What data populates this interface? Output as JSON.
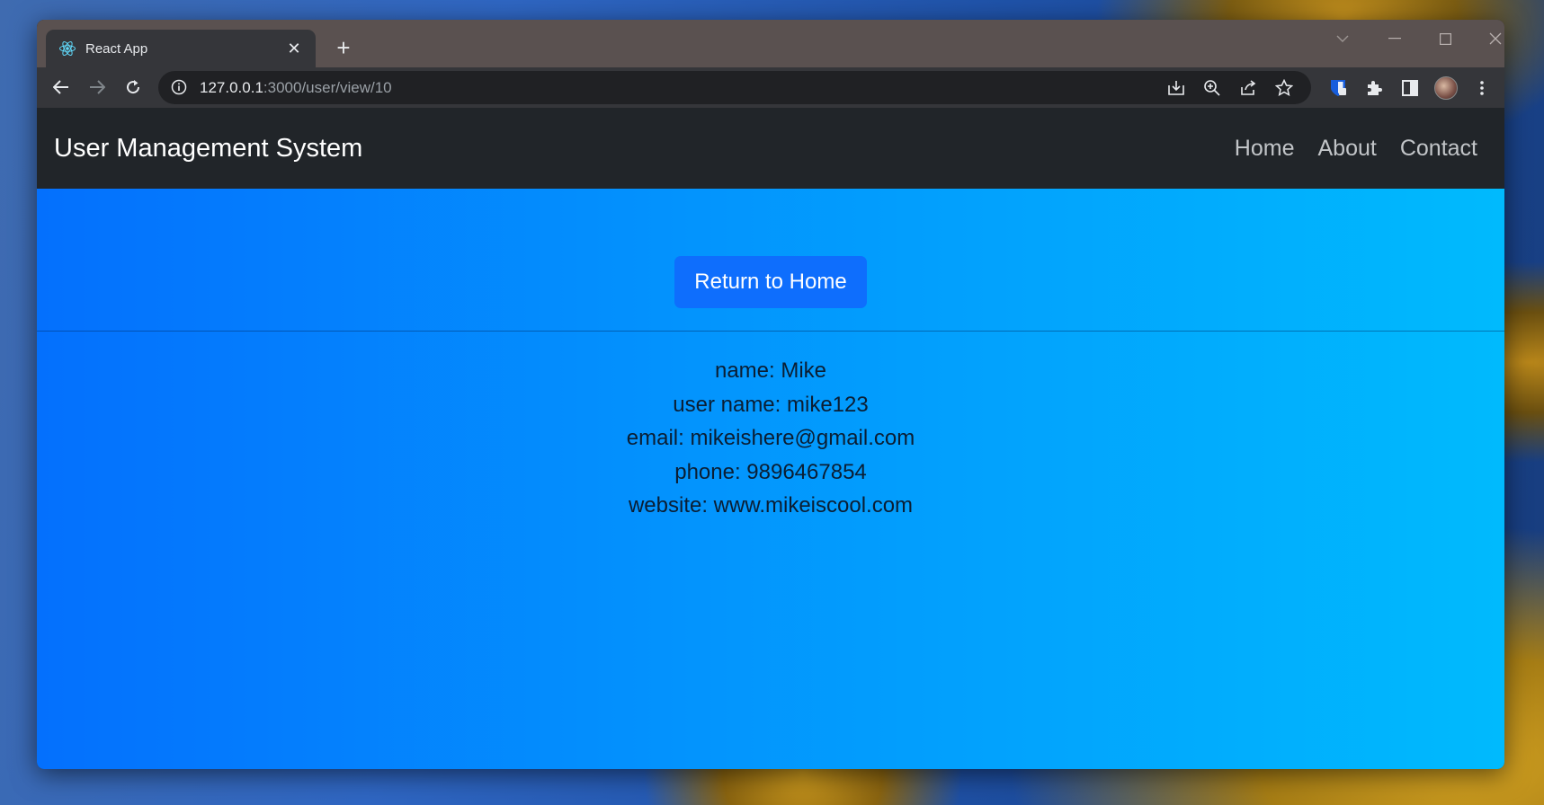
{
  "browser": {
    "tab_title": "React App",
    "new_tab_symbol": "+",
    "tab_close_symbol": "✕",
    "url_host": "127.0.0.1",
    "url_rest": ":3000/user/view/10"
  },
  "navbar": {
    "brand": "User Management System",
    "links": [
      "Home",
      "About",
      "Contact"
    ]
  },
  "main": {
    "return_button": "Return to Home",
    "details": [
      "name: Mike",
      "user name: mike123",
      "email: mikeishere@gmail.com",
      "phone: 9896467854",
      "website: www.mikeiscool.com"
    ]
  },
  "colors": {
    "navbar_bg": "#212529",
    "button_bg": "#0e6efd",
    "gradient_start": "#0470fd",
    "gradient_end": "#00bafd"
  }
}
